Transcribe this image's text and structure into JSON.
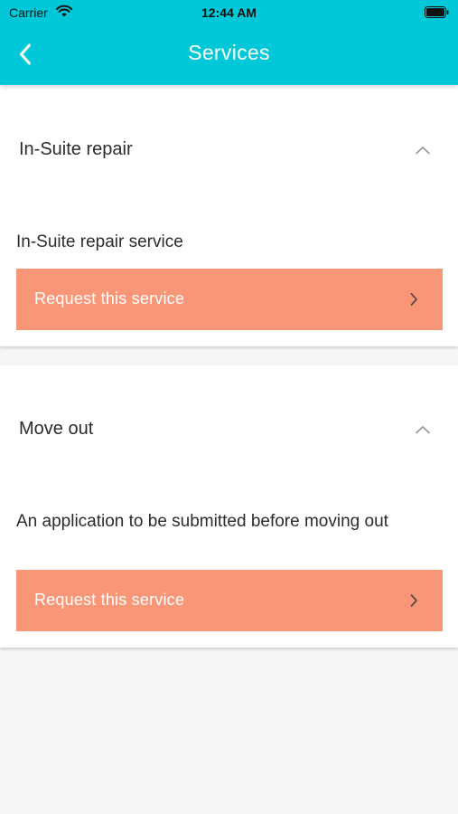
{
  "status_bar": {
    "carrier": "Carrier",
    "time": "12:44 AM",
    "icons": [
      "wifi-icon",
      "battery-icon"
    ]
  },
  "nav": {
    "title": "Services",
    "back_icon": "chevron-left-icon"
  },
  "colors": {
    "header": "#00c8d8",
    "button": "#fa9678",
    "background": "#f6f6f6",
    "card": "#ffffff"
  },
  "services": [
    {
      "title": "In-Suite repair",
      "description": "In-Suite repair service",
      "button_label": "Request this service",
      "expanded": true
    },
    {
      "title": "Move out",
      "description": "An application to be submitted before moving out",
      "button_label": "Request this service",
      "expanded": true
    }
  ]
}
